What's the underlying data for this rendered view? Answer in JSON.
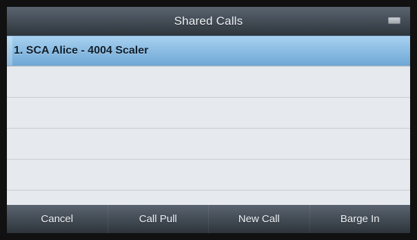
{
  "header": {
    "title": "Shared Calls"
  },
  "list": {
    "items": [
      {
        "label": "1. SCA Alice - 4004 Scaler"
      }
    ]
  },
  "softkeys": [
    {
      "label": "Cancel"
    },
    {
      "label": "Call Pull"
    },
    {
      "label": "New Call"
    },
    {
      "label": "Barge In"
    }
  ]
}
